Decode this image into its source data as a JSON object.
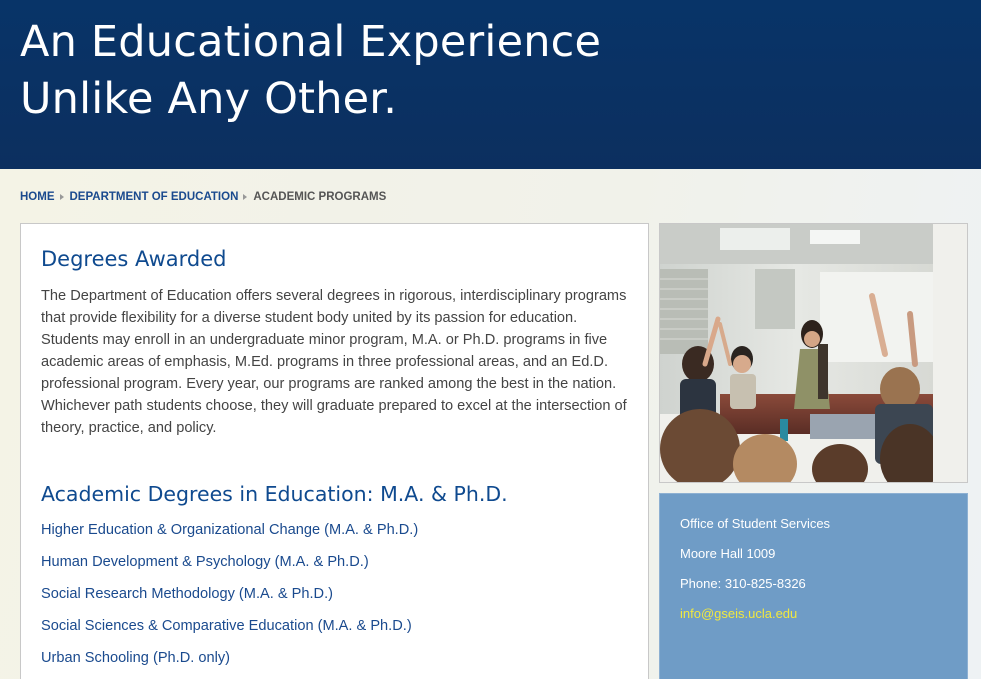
{
  "hero": {
    "title_line1": "An Educational Experience",
    "title_line2": "Unlike Any Other."
  },
  "breadcrumb": {
    "items": [
      "HOME",
      "DEPARTMENT OF EDUCATION"
    ],
    "current": "ACADEMIC PROGRAMS"
  },
  "main": {
    "degrees_heading": "Degrees Awarded",
    "intro": "The Department of Education offers several degrees in rigorous, interdisciplinary programs that provide flexibility for a diverse student body united by its passion for education. Students may enroll in an undergraduate minor program, M.A. or Ph.D. programs in five academic areas of emphasis, M.Ed. programs in three professional areas, and an Ed.D. professional program. Every year, our programs are ranked among the best in the nation. Whichever path students choose, they will graduate prepared to excel at the intersection of theory, practice, and policy.",
    "academic_heading": "Academic Degrees in Education: M.A. & Ph.D.",
    "programs": [
      "Higher Education & Organizational Change (M.A. & Ph.D.)",
      "Human Development & Psychology (M.A. & Ph.D.)",
      "Social Research Methodology (M.A. & Ph.D.)",
      "Social Sciences & Comparative Education (M.A. & Ph.D.)",
      "Urban Schooling (Ph.D. only)"
    ]
  },
  "sidebar": {
    "photo_icon": "classroom-photo",
    "contact": {
      "office": "Office of Student Services",
      "location": "Moore Hall 1009",
      "phone": "Phone: 310-825-8326",
      "email": "info@gseis.ucla.edu"
    }
  },
  "colors": {
    "hero_bg": "#083468",
    "link": "#1a4a8e",
    "heading": "#0f4a8f",
    "contact_bg": "#6f9cc6",
    "email": "#f0e840"
  }
}
